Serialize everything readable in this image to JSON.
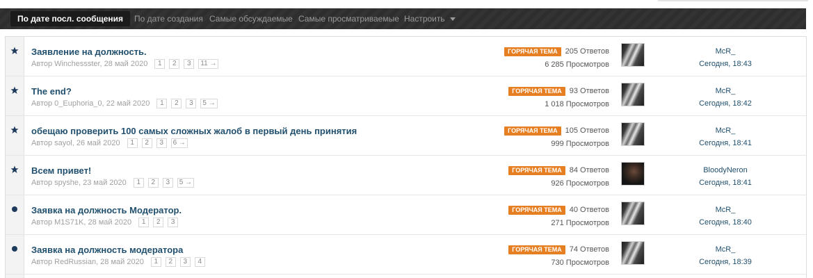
{
  "filters": {
    "tabs": [
      {
        "label": "По дате посл. сообщения",
        "active": true
      },
      {
        "label": "По дате создания",
        "active": false
      },
      {
        "label": "Самые обсуждаемые",
        "active": false
      },
      {
        "label": "Самые просматриваемые",
        "active": false
      },
      {
        "label": "Настроить",
        "active": false
      }
    ]
  },
  "colors": {
    "accent_link": "#21506e",
    "hot_badge": "#e67e22",
    "filterbar_bg": "#2f2f2f"
  },
  "topics": [
    {
      "icon": "star-icon",
      "title": "Заявление на должность.",
      "author": "Автор Winchessster, 28 май 2020",
      "pages": [
        "1",
        "2",
        "3",
        "11 →"
      ],
      "hot_label": "ГОРЯЧАЯ ТЕМА",
      "replies": "205 Ответов",
      "views": "6 285 Просмотров",
      "avatar": "waterfall",
      "last_author": "McR_",
      "last_time": "Сегодня, 18:43"
    },
    {
      "icon": "star-icon",
      "title": "The end?",
      "author": "Автор 0_Euphoria_0, 22 май 2020",
      "pages": [
        "1",
        "2",
        "3",
        "5 →"
      ],
      "hot_label": "ГОРЯЧАЯ ТЕМА",
      "replies": "93 Ответов",
      "views": "1 018 Просмотров",
      "avatar": "waterfall",
      "last_author": "McR_",
      "last_time": "Сегодня, 18:42"
    },
    {
      "icon": "star-icon",
      "title": "обещаю проверить 100 самых сложных жалоб в первый день принятия",
      "author": "Автор sayol, 26 май 2020",
      "pages": [
        "1",
        "2",
        "3",
        "6 →"
      ],
      "hot_label": "ГОРЯЧАЯ ТЕМА",
      "replies": "105 Ответов",
      "views": "999 Просмотров",
      "avatar": "waterfall",
      "last_author": "McR_",
      "last_time": "Сегодня, 18:41"
    },
    {
      "icon": "star-icon",
      "title": "Всем привет!",
      "author": "Автор spyshe, 23 май 2020",
      "pages": [
        "1",
        "2",
        "3",
        "5 →"
      ],
      "hot_label": "ГОРЯЧАЯ ТЕМА",
      "replies": "84 Ответов",
      "views": "926 Просмотров",
      "avatar": "person",
      "last_author": "BloodyNeron",
      "last_time": "Сегодня, 18:41"
    },
    {
      "icon": "dot-icon",
      "title": "Заявка на должность Модератор.",
      "author": "Автор M1S71K, 28 май 2020",
      "pages": [
        "1",
        "2",
        "3"
      ],
      "hot_label": "ГОРЯЧАЯ ТЕМА",
      "replies": "40 Ответов",
      "views": "271 Просмотров",
      "avatar": "waterfall",
      "last_author": "McR_",
      "last_time": "Сегодня, 18:40"
    },
    {
      "icon": "dot-icon",
      "title": "Заявка на должность модератора",
      "author": "Автор RedRussian, 28 май 2020",
      "pages": [
        "1",
        "2",
        "3",
        "4"
      ],
      "hot_label": "ГОРЯЧАЯ ТЕМА",
      "replies": "74 Ответов",
      "views": "730 Просмотров",
      "avatar": "waterfall",
      "last_author": "McR_",
      "last_time": "Сегодня, 18:39"
    }
  ]
}
